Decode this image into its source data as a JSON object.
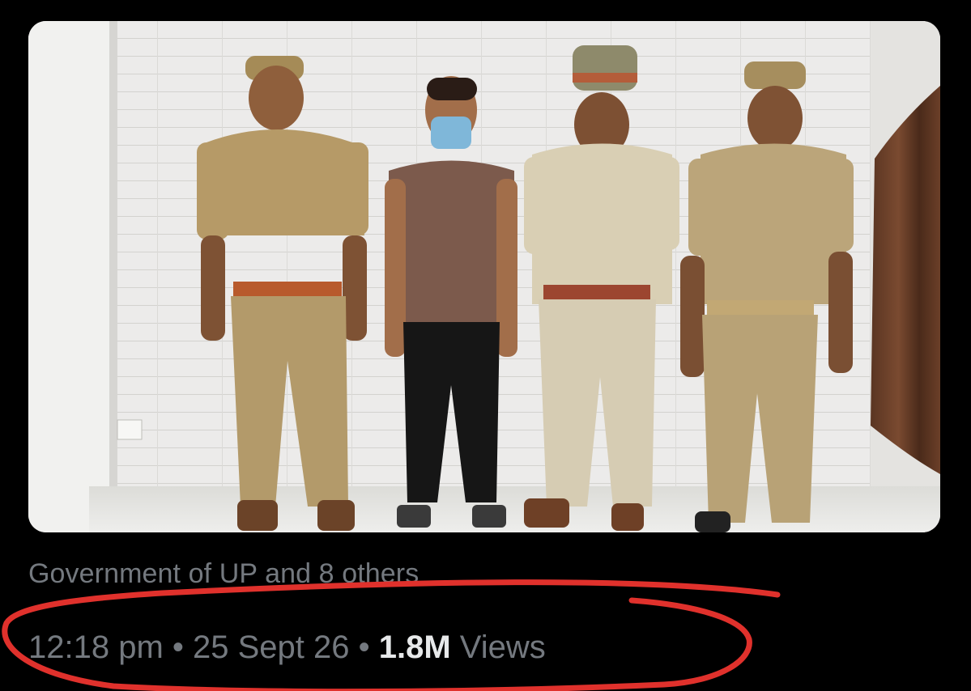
{
  "post": {
    "tagged_text": "Government of UP and 8 others",
    "time": "12:18 pm",
    "separator": " • ",
    "date": "25 Sept 26",
    "views_count": "1.8M",
    "views_label": " Views"
  },
  "colors": {
    "background": "#000000",
    "muted_text": "#74797f",
    "primary_text": "#e7e9ea",
    "annotation_red": "#e0312c"
  }
}
